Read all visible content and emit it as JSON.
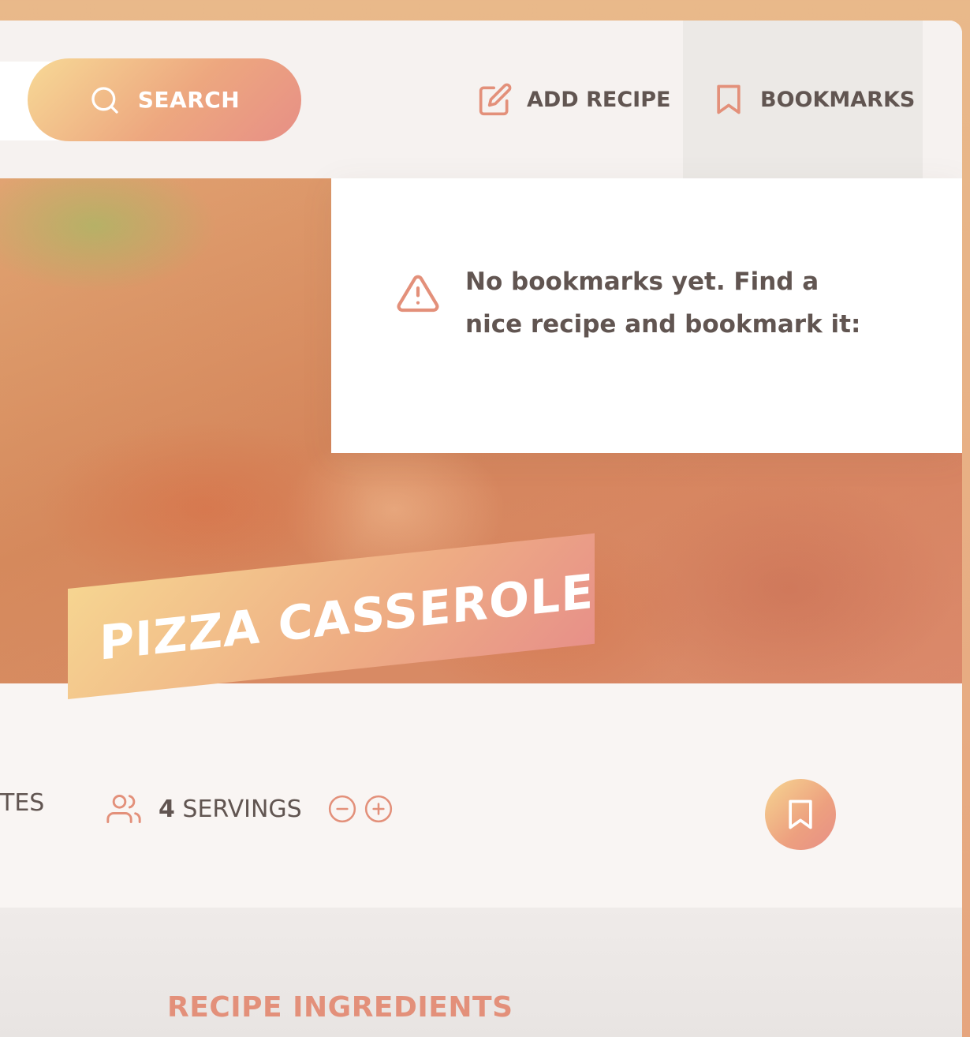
{
  "header": {
    "search_button_label": "SEARCH",
    "add_recipe_label": "ADD RECIPE",
    "bookmarks_label": "BOOKMARKS"
  },
  "bookmarks_panel": {
    "message": "No bookmarks yet. Find a nice recipe and bookmark it:"
  },
  "recipe": {
    "title": "PIZZA CASSEROLE",
    "minutes_label_partial": "TES",
    "servings_count": "4",
    "servings_label": "SERVINGS"
  },
  "ingredients": {
    "heading": "RECIPE INGREDIENTS"
  },
  "colors": {
    "accent_start": "#f7d996",
    "accent_end": "#e78f86",
    "text": "#615551",
    "icon": "#e3907a"
  },
  "icons": {
    "search": "search-icon",
    "add_recipe": "edit-icon",
    "bookmarks": "bookmark-icon",
    "warning": "warning-icon",
    "users": "users-icon",
    "minus": "minus-circle-icon",
    "plus": "plus-circle-icon"
  }
}
